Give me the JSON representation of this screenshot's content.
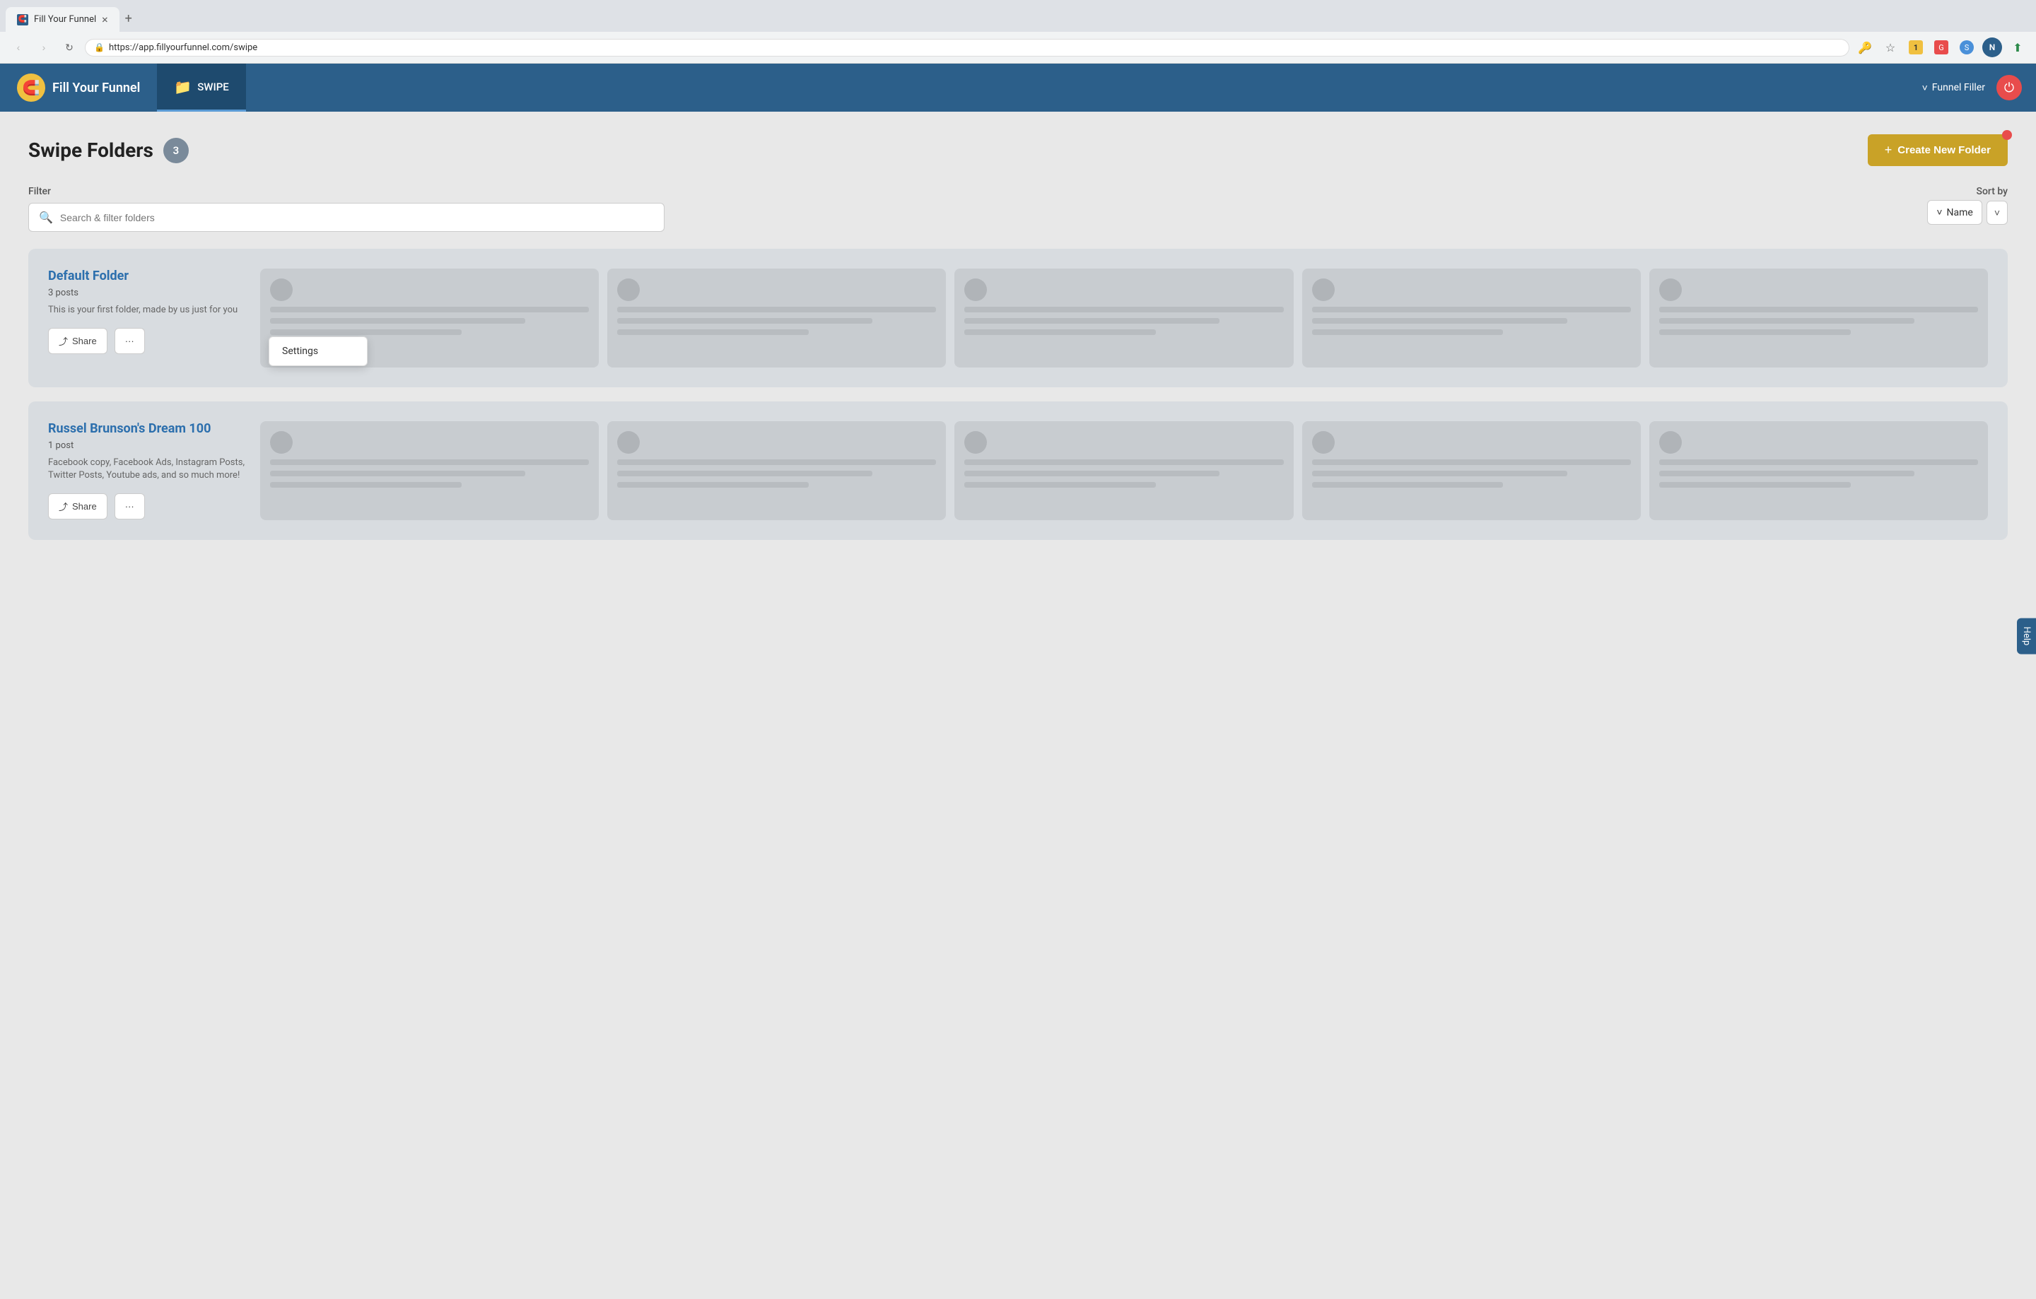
{
  "browser": {
    "tab_title": "Fill Your Funnel",
    "tab_close": "×",
    "tab_new": "+",
    "url": "https://app.fillyourfunnel.com/swipe",
    "nav_back": "‹",
    "nav_forward": "›",
    "nav_reload": "↻"
  },
  "header": {
    "logo_text": "Fill Your Funnel",
    "nav_swipe": "SWIPE",
    "funnel_filler_label": "Funnel Filler",
    "power_icon": "⏻"
  },
  "page": {
    "title": "Swipe Folders",
    "count": "3",
    "create_button": "Create New Folder",
    "create_icon": "+"
  },
  "filter": {
    "label": "Filter",
    "search_placeholder": "Search & filter folders"
  },
  "sort": {
    "label": "Sort by",
    "current": "Name",
    "chevron_down": "˅",
    "direction_icon": "˅"
  },
  "folders": [
    {
      "id": "default",
      "name": "Default Folder",
      "posts": "3 posts",
      "description": "This is your first folder, made by us just for you",
      "share_label": "Share",
      "more_label": "···",
      "has_context_menu": true,
      "context_menu_item": "Settings"
    },
    {
      "id": "russel",
      "name": "Russel Brunson's Dream 100",
      "posts": "1 post",
      "description": "Facebook copy, Facebook Ads, Instagram Posts, Twitter Posts, Youtube ads, and so much more!",
      "share_label": "Share",
      "more_label": "···",
      "has_context_menu": false,
      "context_menu_item": ""
    }
  ],
  "help": {
    "label": "Help"
  }
}
